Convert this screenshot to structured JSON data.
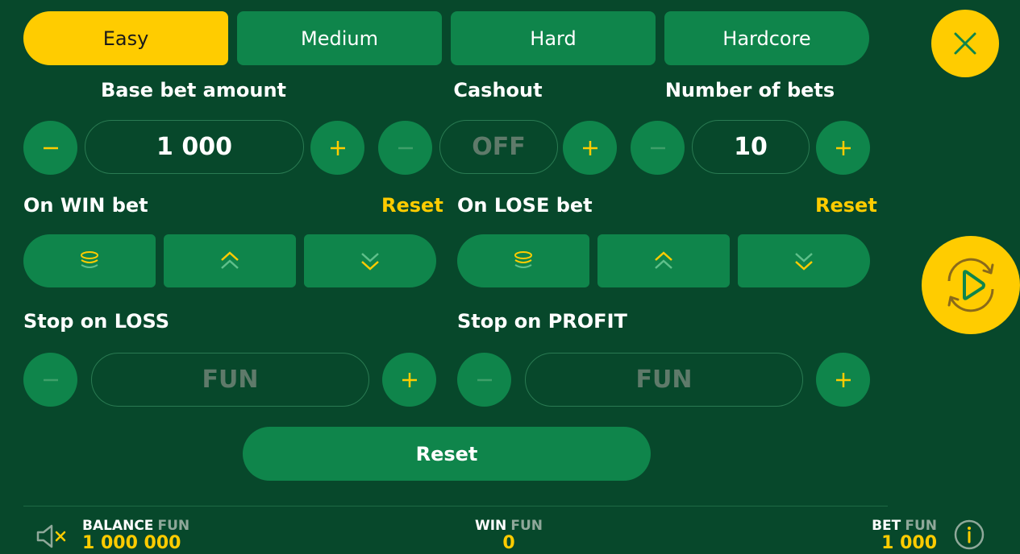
{
  "difficulty_tabs": [
    "Easy",
    "Medium",
    "Hard",
    "Hardcore"
  ],
  "labels": {
    "base_bet": "Base bet amount",
    "cashout": "Cashout",
    "number_of_bets": "Number of bets",
    "on_win": "On WIN bet",
    "on_lose": "On LOSE bet",
    "stop_loss": "Stop on LOSS",
    "stop_profit": "Stop on PROFIT",
    "reset": "Reset"
  },
  "values": {
    "base_bet": "1 000",
    "cashout": "OFF",
    "number_of_bets": "10",
    "stop_loss_placeholder": "FUN",
    "stop_profit_placeholder": "FUN"
  },
  "main_reset_button": "Reset",
  "footer": {
    "balance_label": "BALANCE",
    "balance_currency": "FUN",
    "balance_value": "1 000 000",
    "win_label": "WIN",
    "win_currency": "FUN",
    "win_value": "0",
    "bet_label": "BET",
    "bet_currency": "FUN",
    "bet_value": "1 000"
  },
  "colors": {
    "background": "#07482b",
    "button": "#0f854b",
    "accent": "#ffcc00"
  },
  "icons": [
    "minus-icon",
    "plus-icon",
    "coins-icon",
    "double-chevron-up-icon",
    "double-chevron-down-icon",
    "close-icon",
    "autoplay-icon",
    "sound-muted-icon",
    "info-icon"
  ]
}
